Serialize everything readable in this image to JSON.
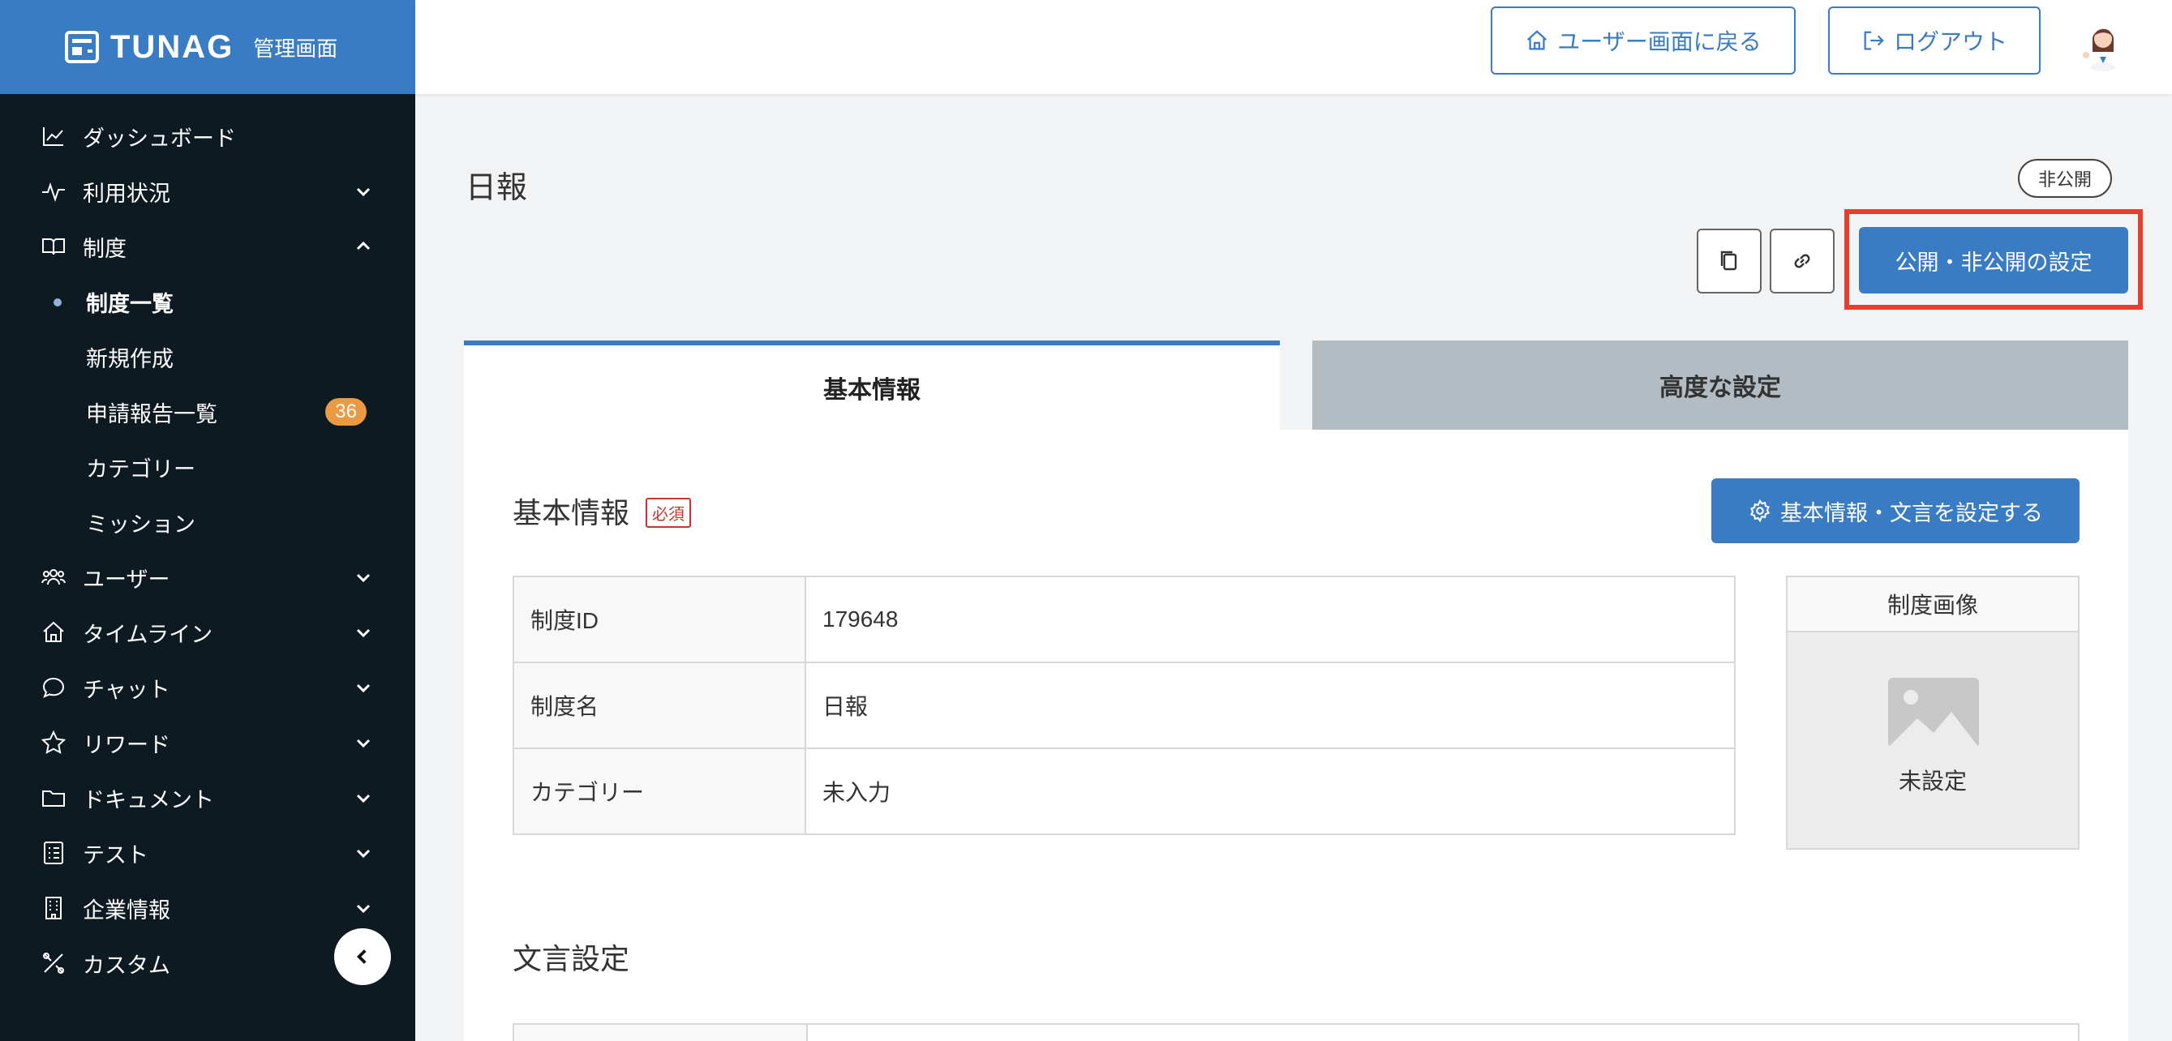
{
  "brand": {
    "name": "TUNAG",
    "sub": "管理画面"
  },
  "sidebar": {
    "items": [
      {
        "label": "ダッシュボード"
      },
      {
        "label": "利用状況"
      },
      {
        "label": "制度"
      },
      {
        "label": "ユーザー"
      },
      {
        "label": "タイムライン"
      },
      {
        "label": "チャット"
      },
      {
        "label": "リワード"
      },
      {
        "label": "ドキュメント"
      },
      {
        "label": "テスト"
      },
      {
        "label": "企業情報"
      },
      {
        "label": "カスタム"
      }
    ],
    "subitems": [
      {
        "label": "制度一覧"
      },
      {
        "label": "新規作成"
      },
      {
        "label": "申請報告一覧",
        "badge": "36"
      },
      {
        "label": "カテゴリー"
      },
      {
        "label": "ミッション"
      }
    ]
  },
  "header": {
    "user_screen_label": "ユーザー画面に戻る",
    "logout_label": "ログアウト"
  },
  "page": {
    "title": "日報",
    "status": "非公開",
    "publish_button": "公開・非公開の設定"
  },
  "tabs": [
    {
      "label": "基本情報"
    },
    {
      "label": "高度な設定"
    }
  ],
  "basic": {
    "section_title": "基本情報",
    "required": "必須",
    "settings_button": "基本情報・文言を設定する",
    "rows": [
      {
        "key": "制度ID",
        "value": "179648"
      },
      {
        "key": "制度名",
        "value": "日報"
      },
      {
        "key": "カテゴリー",
        "value": "未入力"
      }
    ],
    "image_header": "制度画像",
    "image_caption": "未設定"
  },
  "wording": {
    "section_title": "文言設定"
  },
  "colors": {
    "brand": "#3a7cc3",
    "sidebar": "#0d1a22",
    "highlight": "#e2422b",
    "badge": "#e99a43"
  }
}
